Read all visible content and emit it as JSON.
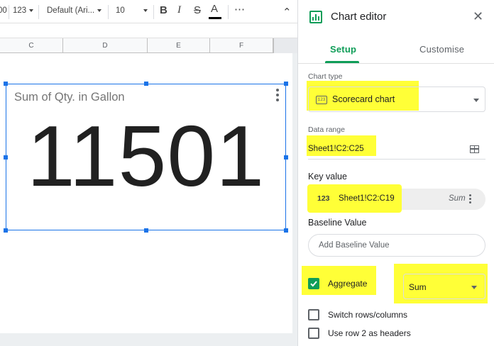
{
  "toolbar": {
    "partial_zoom": "00",
    "number_format": "123",
    "font_family": "Default (Ari...",
    "font_size": "10",
    "bold": "B",
    "italic": "I",
    "strike": "S",
    "font_color": "A",
    "more": "⋯",
    "collapse": "⌃"
  },
  "columns": [
    "C",
    "D",
    "E",
    "F"
  ],
  "chart": {
    "title": "Sum of Qty. in Gallon",
    "value": "11501"
  },
  "editor": {
    "title": "Chart editor",
    "close": "✕",
    "tabs": [
      {
        "label": "Setup",
        "active": true
      },
      {
        "label": "Customise",
        "active": false
      }
    ],
    "chart_type": {
      "label": "Chart type",
      "value": "Scorecard chart",
      "icon_text": "123"
    },
    "data_range": {
      "label": "Data range",
      "value": "Sheet1!C2:C25"
    },
    "key_value": {
      "label": "Key value",
      "icon": "123",
      "range": "Sheet1!C2:C19",
      "aggregation": "Sum"
    },
    "baseline": {
      "label": "Baseline Value",
      "placeholder": "Add Baseline Value"
    },
    "aggregate": {
      "label": "Aggregate",
      "checked": true,
      "function": "Sum"
    },
    "options": [
      {
        "label": "Switch rows/columns",
        "checked": false
      },
      {
        "label": "Use row 2 as headers",
        "checked": false
      }
    ]
  },
  "colors": {
    "accent_green": "#0f9d58",
    "selection_blue": "#1a73e8",
    "highlight_yellow": "#ffff37"
  }
}
